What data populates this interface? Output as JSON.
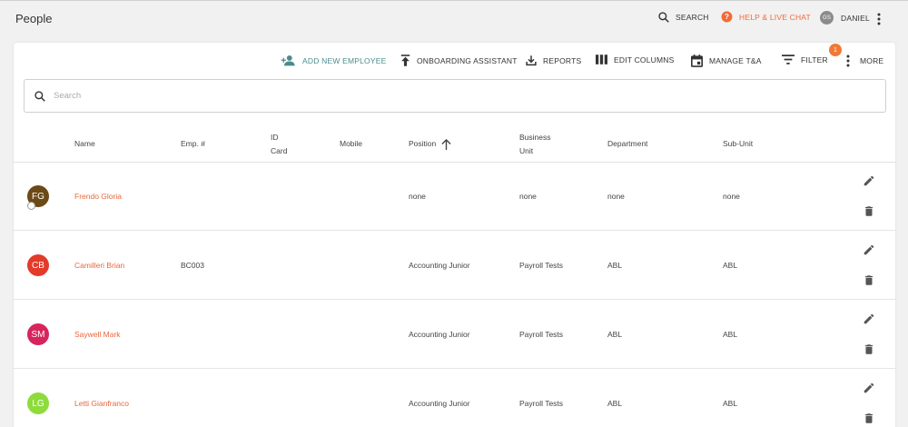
{
  "header": {
    "title": "People",
    "search_label": "SEARCH",
    "help_label": "HELP & LIVE CHAT",
    "user_initials": "GS",
    "user_name": "DANIEL"
  },
  "toolbar": {
    "add_employee": "ADD NEW EMPLOYEE",
    "onboarding": "ONBOARDING ASSISTANT",
    "reports": "REPORTS",
    "edit_columns": "EDIT COLUMNS",
    "manage_tna": "MANAGE T&A",
    "filter": "FILTER",
    "filter_count": "1",
    "more": "MORE"
  },
  "search": {
    "placeholder": "Search"
  },
  "table": {
    "columns": {
      "name": "Name",
      "emp_no": "Emp. #",
      "id_card_1": "ID",
      "id_card_2": "Card",
      "mobile": "Mobile",
      "position": "Position",
      "business_unit_1": "Business",
      "business_unit_2": "Unit",
      "department": "Department",
      "sub_unit": "Sub-Unit"
    },
    "rows": [
      {
        "initials": "FG",
        "color": "#6b4a16",
        "name": "Frendo Gloria",
        "emp_no": "",
        "position": "none",
        "business_unit": "none",
        "department": "none",
        "sub_unit": "none"
      },
      {
        "initials": "CB",
        "color": "#e43a2a",
        "name": "Camilleri Brian",
        "emp_no": "BC003",
        "position": "Accounting Junior",
        "business_unit": "Payroll Tests",
        "department": "ABL",
        "sub_unit": "ABL"
      },
      {
        "initials": "SM",
        "color": "#d8245c",
        "name": "Saywell Mark",
        "emp_no": "",
        "position": "Accounting Junior",
        "business_unit": "Payroll Tests",
        "department": "ABL",
        "sub_unit": "ABL"
      },
      {
        "initials": "LG",
        "color": "#8edb3c",
        "name": "Letti Gianfranco",
        "emp_no": "",
        "position": "Accounting Junior",
        "business_unit": "Payroll Tests",
        "department": "ABL",
        "sub_unit": "ABL"
      }
    ]
  },
  "colors": {
    "accent": "#f06b36",
    "link": "#e8673c",
    "teal": "#4c8c8c"
  }
}
